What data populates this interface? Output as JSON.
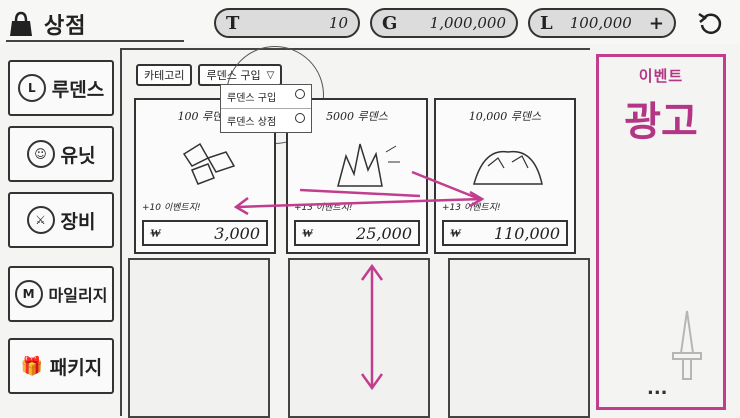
{
  "header": {
    "title": "상점",
    "icon": "shopping-bag-icon",
    "currencies": [
      {
        "label": "T",
        "value": "10"
      },
      {
        "label": "G",
        "value": "1,000,000"
      },
      {
        "label": "L",
        "value": "100,000"
      }
    ],
    "add_symbol": "+",
    "refresh_icon": "refresh-icon"
  },
  "sidebar": {
    "items": [
      {
        "label": "루덴스",
        "icon": "L"
      },
      {
        "label": "유닛",
        "icon": "☺"
      },
      {
        "label": "장비",
        "icon": "⚔"
      },
      {
        "label": "마일리지",
        "icon": "M"
      },
      {
        "label": "패키지",
        "icon": "🎁"
      }
    ]
  },
  "filters": {
    "category": "카테고리",
    "sort": "루덴스 구입",
    "sort_arrow": "▽",
    "options": [
      "루덴스 구입",
      "루덴스 상점"
    ]
  },
  "products": [
    {
      "name": "100 루덴스",
      "extra": "+10 이벤트지!",
      "price": "3,000"
    },
    {
      "name": "5000 루덴스",
      "extra": "+13 이벤트지!",
      "price": "25,000"
    },
    {
      "name": "10,000 루덴스",
      "extra": "+13 이벤트지!",
      "price": "110,000"
    }
  ],
  "event": {
    "title": "이벤트",
    "body": "광고",
    "dots": "..."
  },
  "colors": {
    "accent": "#c23d8e",
    "ink": "#333333"
  }
}
